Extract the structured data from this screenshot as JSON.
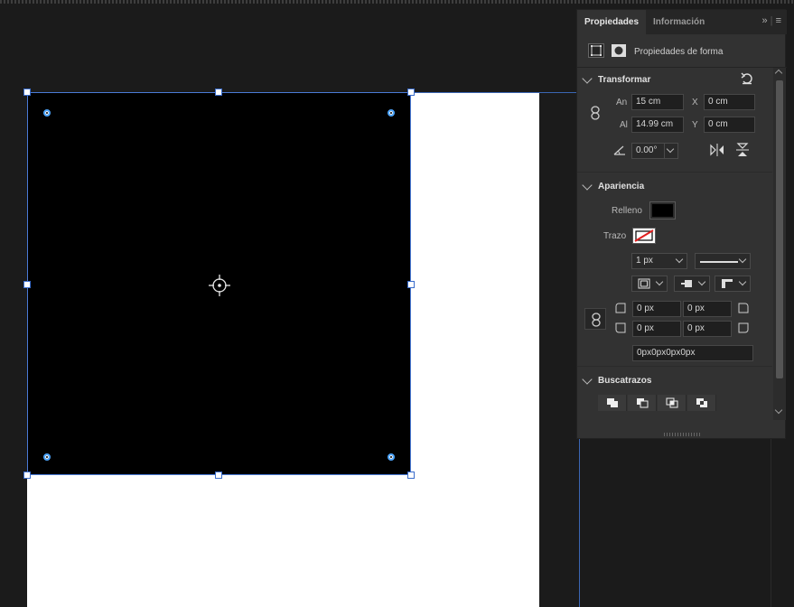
{
  "panel": {
    "tabs": {
      "active": "Propiedades",
      "inactive": "Información"
    },
    "mode_label": "Propiedades de forma",
    "transform": {
      "title": "Transformar",
      "width_label": "An",
      "width": "15 cm",
      "height_label": "Al",
      "height": "14.99 cm",
      "x_label": "X",
      "x": "0 cm",
      "y_label": "Y",
      "y": "0 cm",
      "angle": "0.00°"
    },
    "appearance": {
      "title": "Apariencia",
      "fill_label": "Relleno",
      "stroke_label": "Trazo",
      "stroke_width": "1 px",
      "corner_tl": "0 px",
      "corner_tr": "0 px",
      "corner_bl": "0 px",
      "corner_br": "0 px",
      "corners_combined": "0px0px0px0px"
    },
    "pathfinder": {
      "title": "Buscatrazos"
    }
  },
  "colors": {
    "fill": "#000000",
    "accent": "#4a7ad6",
    "panel_bg": "#323232"
  },
  "icons": [
    "link-icon",
    "reset-icon",
    "angle-icon",
    "flip-horizontal-icon",
    "flip-vertical-icon",
    "menu-icon",
    "expand-icon"
  ]
}
